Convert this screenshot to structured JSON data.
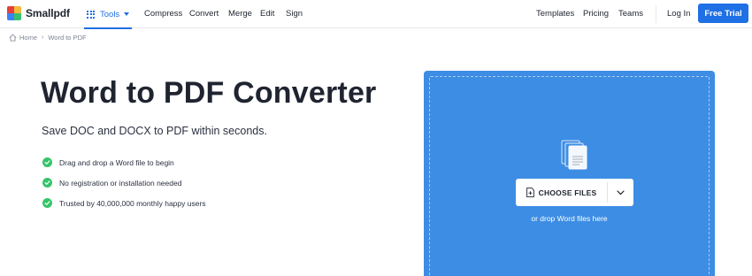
{
  "brand": {
    "name": "Smallpdf",
    "logo_colors": [
      "#e53e3e",
      "#f6b93b",
      "#3b82f6",
      "#38c172"
    ]
  },
  "nav": {
    "tools_label": "Tools",
    "links": [
      "Compress",
      "Convert",
      "Merge",
      "Edit",
      "Sign"
    ],
    "right_links": [
      "Templates",
      "Pricing",
      "Teams"
    ],
    "login_label": "Log In",
    "cta_label": "Free Trial"
  },
  "breadcrumb": {
    "home": "Home",
    "current": "Word to PDF"
  },
  "hero": {
    "title": "Word to PDF Converter",
    "subtitle": "Save DOC and DOCX to PDF within seconds.",
    "features": [
      "Drag and drop a Word file to begin",
      "No registration or installation needed",
      "Trusted by 40,000,000 monthly happy users"
    ]
  },
  "dropzone": {
    "button_label": "CHOOSE FILES",
    "drop_text": "or drop Word files here"
  },
  "colors": {
    "accent": "#1f6fe5",
    "dropzone": "#3d8de4",
    "check": "#36c46b"
  }
}
